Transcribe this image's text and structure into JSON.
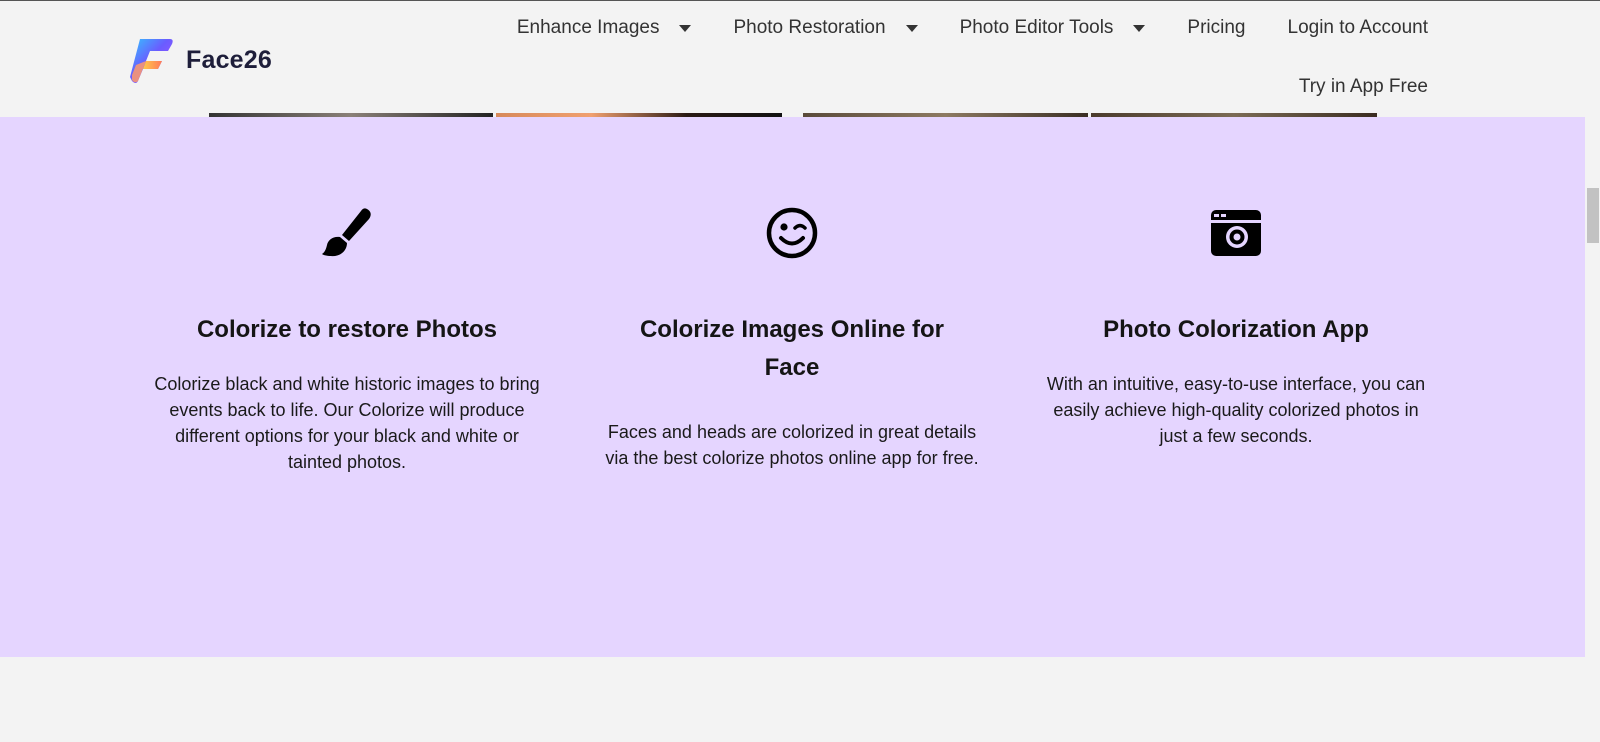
{
  "brand": {
    "name": "Face26",
    "logo_colors": [
      "#6a5cff",
      "#ff7a59",
      "#ffc94a",
      "#33c5ff"
    ]
  },
  "nav": {
    "items": [
      {
        "label": "Enhance Images",
        "has_dropdown": true
      },
      {
        "label": "Photo Restoration",
        "has_dropdown": true
      },
      {
        "label": "Photo Editor Tools",
        "has_dropdown": true
      },
      {
        "label": "Pricing",
        "has_dropdown": false
      },
      {
        "label": "Login to Account",
        "has_dropdown": false
      }
    ],
    "try_label": "Try in App Free"
  },
  "features": {
    "background": "#e5d5ff",
    "items": [
      {
        "icon": "paintbrush-icon",
        "title": "Colorize to restore Photos",
        "text": "Colorize black and white historic images to bring events back to life. Our Colorize will produce different options for your black and white or tainted photos."
      },
      {
        "icon": "wink-face-icon",
        "title": "Colorize Images Online for Face",
        "text": "Faces and heads are colorized in great details via the best colorize photos online app for free."
      },
      {
        "icon": "camera-icon",
        "title": "Photo Colorization App",
        "text": "With an intuitive, easy-to-use interface, you can easily achieve high-quality colorized photos in just a few seconds."
      }
    ]
  }
}
